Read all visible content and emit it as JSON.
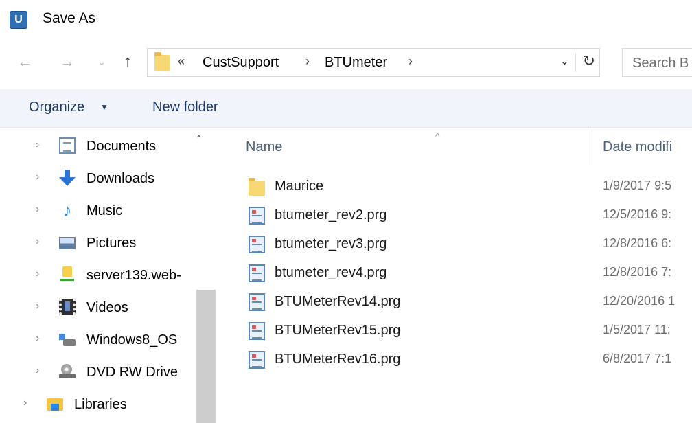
{
  "window": {
    "title": "Save As",
    "icon": "ultraedit-app-icon"
  },
  "navigation": {
    "back": "←",
    "forward": "→",
    "recent": "⌄",
    "up": "↑"
  },
  "address": {
    "overflow": "«",
    "crumbs": [
      "CustSupport",
      "BTUmeter"
    ],
    "separator": "›",
    "dropdown": "⌄",
    "refresh": "↻"
  },
  "search": {
    "placeholder": "Search B"
  },
  "toolbar": {
    "organize": "Organize",
    "organize_caret": "▼",
    "new_folder": "New folder"
  },
  "nav_pane": {
    "scroll_up": "⌃",
    "items": [
      {
        "label": "Documents",
        "icon": "documents-icon",
        "expander": "›"
      },
      {
        "label": "Downloads",
        "icon": "downloads-icon",
        "expander": "›"
      },
      {
        "label": "Music",
        "icon": "music-icon",
        "expander": "›"
      },
      {
        "label": "Pictures",
        "icon": "pictures-icon",
        "expander": "›"
      },
      {
        "label": "server139.web-",
        "icon": "network-drive-icon",
        "expander": "›"
      },
      {
        "label": "Videos",
        "icon": "videos-icon",
        "expander": "›"
      },
      {
        "label": "Windows8_OS",
        "icon": "os-drive-icon",
        "expander": "›"
      },
      {
        "label": "DVD RW Drive",
        "icon": "dvd-drive-icon",
        "expander": "›"
      },
      {
        "label": "Libraries",
        "icon": "libraries-icon",
        "expander": "›"
      }
    ]
  },
  "file_list": {
    "columns": {
      "name": "Name",
      "date": "Date modifi",
      "sort_indicator": "^"
    },
    "rows": [
      {
        "name": "Maurice",
        "date": "1/9/2017 9:5",
        "type": "folder"
      },
      {
        "name": "btumeter_rev2.prg",
        "date": "12/5/2016 9:",
        "type": "prg"
      },
      {
        "name": "btumeter_rev3.prg",
        "date": "12/8/2016 6:",
        "type": "prg"
      },
      {
        "name": "btumeter_rev4.prg",
        "date": "12/8/2016 7:",
        "type": "prg"
      },
      {
        "name": "BTUMeterRev14.prg",
        "date": "12/20/2016 1",
        "type": "prg"
      },
      {
        "name": "BTUMeterRev15.prg",
        "date": "1/5/2017 11:",
        "type": "prg"
      },
      {
        "name": "BTUMeterRev16.prg",
        "date": "6/8/2017 7:1",
        "type": "prg"
      }
    ]
  }
}
